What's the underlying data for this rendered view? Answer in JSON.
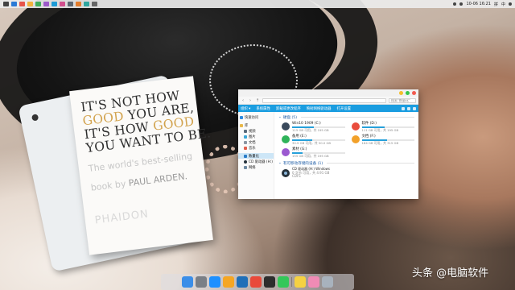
{
  "menubar": {
    "clock": "10-06  16:21",
    "tray_labels": [
      "拼",
      "中"
    ]
  },
  "book": {
    "line1_a": "IT'S NOT HOW",
    "line2_a": "GOOD",
    "line2_b": " YOU ARE,",
    "line3_a": "IT'S HOW ",
    "line3_b": "GOOD",
    "line4_a": "YOU WANT TO BE.",
    "sub1": "The world's best-selling",
    "sub2_a": "book by ",
    "sub2_b": "PAUL ARDEN.",
    "publisher": "PHAIDON"
  },
  "explorer": {
    "title": "",
    "address": "",
    "search_placeholder": "搜索\"数量化\"",
    "ribbon": [
      "组织 ▾",
      "系统属性",
      "卸载或更改程序",
      "映射网络驱动器",
      "打开设置"
    ],
    "sidebar": {
      "quick_access": "快速访问",
      "libraries": [
        "库",
        "视频",
        "图片",
        "文档",
        "音乐"
      ],
      "this_pc": "数量化",
      "cd_drive": "CD 驱动器 (H:)",
      "network": "网络"
    },
    "drives_header": "硬盘 (5)",
    "drives": [
      {
        "name": "Win10 1909 (C:)",
        "free": "115 GB 可用，共 195 GB",
        "fill": 0.41,
        "color": "#3a4a5c"
      },
      {
        "name": "软件 (D:)",
        "free": "111 GB 可用，共 195 GB",
        "fill": 0.43,
        "color": "#e94c3d"
      },
      {
        "name": "备用 (E:)",
        "free": "30.9 GB 可用，共 50.0 GB",
        "fill": 0.38,
        "color": "#2fb35a"
      },
      {
        "name": "文档 (F:)",
        "free": "164 GB 可用，共 315 GB",
        "fill": 0.48,
        "color": "#f2a12a"
      },
      {
        "name": "素材 (G:)",
        "free": "155 GB 可用，共 195 GB",
        "fill": 0.2,
        "color": "#9b59d0"
      }
    ],
    "removable_header": "有可移动存储的设备 (1)",
    "removable": {
      "name": "CD 驱动器 (H:) Windows",
      "line2": "0 字节 可用，共 4.91 GB",
      "line3": "CDFS"
    }
  },
  "dock": {
    "apps": [
      "finder",
      "launchpad",
      "safari",
      "sketch",
      "photoshop",
      "chrome",
      "terminal",
      "messages",
      "notes",
      "photos",
      "trash"
    ]
  },
  "watermark": "头条 @电脑软件"
}
